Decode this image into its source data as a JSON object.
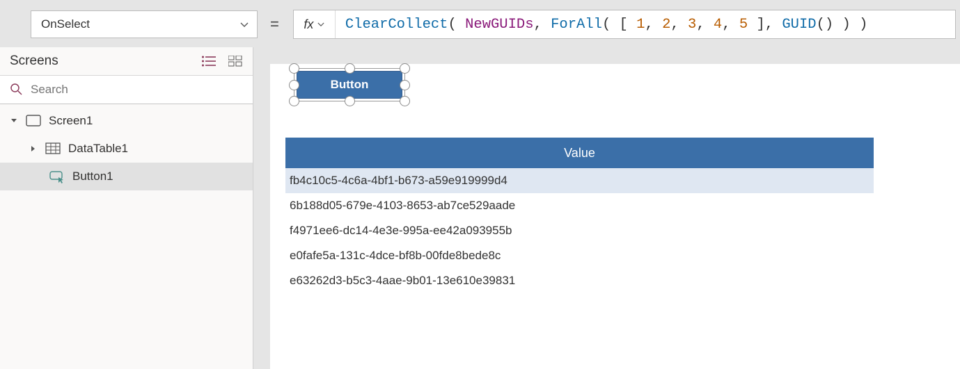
{
  "property_selector": {
    "value": "OnSelect"
  },
  "formula": {
    "tokens": [
      {
        "t": "ClearCollect",
        "c": "fn"
      },
      {
        "t": "( ",
        "c": "name"
      },
      {
        "t": "NewGUIDs",
        "c": "id"
      },
      {
        "t": ", ",
        "c": "name"
      },
      {
        "t": "ForAll",
        "c": "fn"
      },
      {
        "t": "( [ ",
        "c": "name"
      },
      {
        "t": "1",
        "c": "num"
      },
      {
        "t": ", ",
        "c": "name"
      },
      {
        "t": "2",
        "c": "num"
      },
      {
        "t": ", ",
        "c": "name"
      },
      {
        "t": "3",
        "c": "num"
      },
      {
        "t": ", ",
        "c": "name"
      },
      {
        "t": "4",
        "c": "num"
      },
      {
        "t": ", ",
        "c": "name"
      },
      {
        "t": "5",
        "c": "num"
      },
      {
        "t": " ], ",
        "c": "name"
      },
      {
        "t": "GUID",
        "c": "fn"
      },
      {
        "t": "() ) )",
        "c": "name"
      }
    ]
  },
  "screens_panel": {
    "title": "Screens",
    "search_placeholder": "Search"
  },
  "tree": {
    "items": [
      {
        "label": "Screen1",
        "type": "screen"
      },
      {
        "label": "DataTable1",
        "type": "datatable"
      },
      {
        "label": "Button1",
        "type": "button"
      }
    ]
  },
  "canvas_button": {
    "label": "Button"
  },
  "datatable": {
    "header": "Value",
    "rows": [
      "fb4c10c5-4c6a-4bf1-b673-a59e919999d4",
      "6b188d05-679e-4103-8653-ab7ce529aade",
      "f4971ee6-dc14-4e3e-995a-ee42a093955b",
      "e0fafe5a-131c-4dce-bf8b-00fde8bede8c",
      "e63262d3-b5c3-4aae-9b01-13e610e39831"
    ]
  },
  "colors": {
    "primary": "#3b6fa8"
  }
}
